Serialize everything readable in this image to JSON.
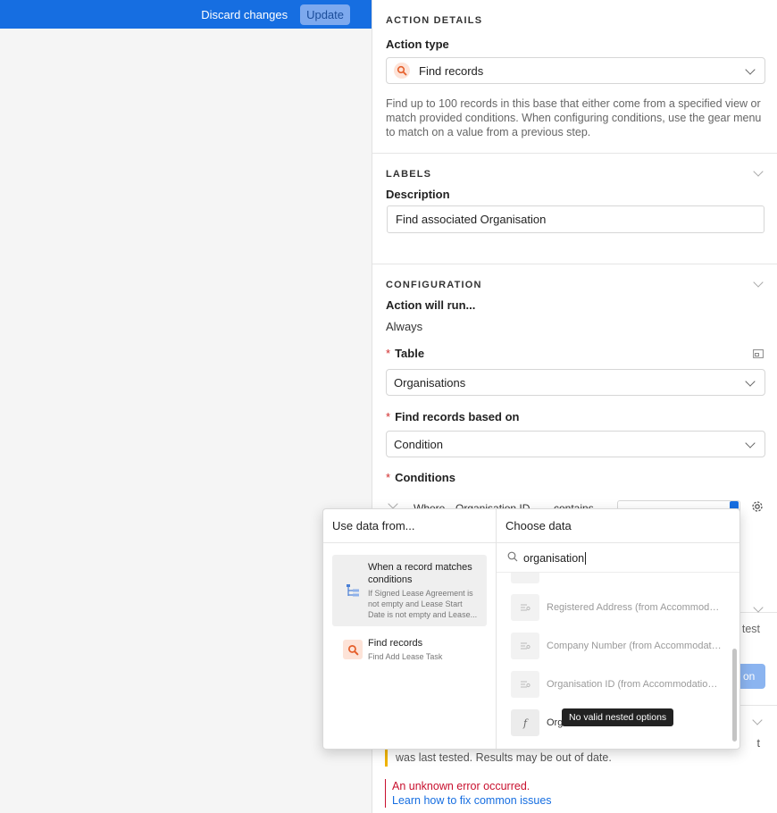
{
  "topbar": {
    "discard_label": "Discard changes",
    "update_label": "Update"
  },
  "action_details": {
    "section_title": "ACTION DETAILS",
    "action_type_label": "Action type",
    "action_type_value": "Find records",
    "description": "Find up to 100 records in this base that either come from a specified view or match provided conditions. When configuring conditions, use the gear menu to match on a value from a previous step."
  },
  "labels": {
    "section_title": "LABELS",
    "description_label": "Description",
    "description_value": "Find associated Organisation"
  },
  "configuration": {
    "section_title": "CONFIGURATION",
    "will_run_label": "Action will run...",
    "will_run_value": "Always",
    "table_label": "Table",
    "table_value": "Organisations",
    "find_based_label": "Find records based on",
    "find_based_value": "Condition",
    "conditions_label": "Conditions",
    "where_label": "Where",
    "field_value": "Organisation ID",
    "operator_value": "contains"
  },
  "test_section": {
    "partial_text": "test",
    "button_partial": "on",
    "warning_partial_1": "t",
    "warning_text": "was last tested. Results may be out of date.",
    "error_text": "An unknown error occurred.",
    "help_link": "Learn how to fix common issues"
  },
  "popup": {
    "left_header": "Use data from...",
    "right_header": "Choose data",
    "search_value": "organisation",
    "sources": [
      {
        "title": "When a record matches conditions",
        "subtitle": "If Signed Lease Agreement is not empty and Lease Start Date is not empty and Lease..."
      },
      {
        "title": "Find records",
        "subtitle": "Find Add Lease Task"
      }
    ],
    "data_items": [
      "Registered Address (from Accommodation...",
      "Company Number (from Accommodation...",
      "Organisation ID (from Accommodation ...",
      "Org"
    ],
    "tooltip": "No valid nested options"
  },
  "colors": {
    "primary_blue": "#166ee1",
    "error_red": "#c8102e",
    "link_blue": "#166ee1",
    "warning_yellow": "#f0b400"
  }
}
